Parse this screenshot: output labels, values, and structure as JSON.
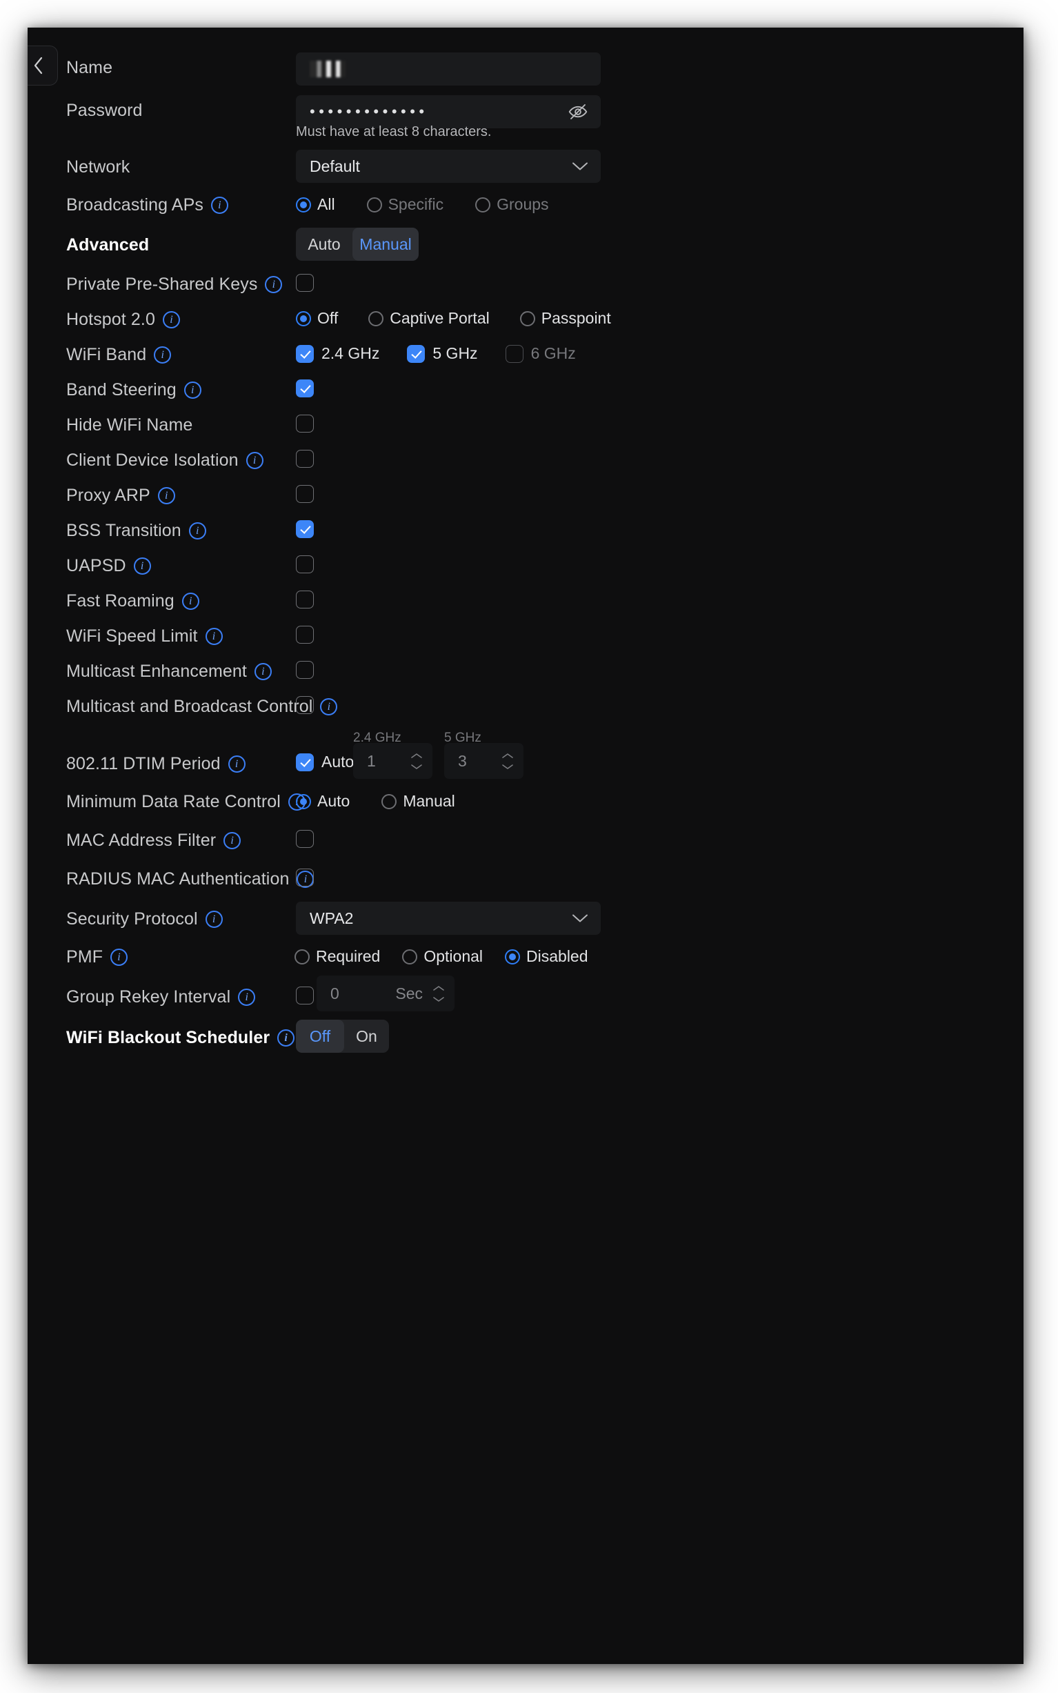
{
  "colors": {
    "panel_bg": "#0e0e0f",
    "accent": "#3d86f8",
    "accent_text": "#5a97fb",
    "field_bg": "#1a1b1d",
    "label": "#c8c9cb",
    "disabled": "#77787c"
  },
  "nav": {
    "back_icon": "chevron-left-icon"
  },
  "fields": {
    "name": {
      "label": "Name",
      "value": "",
      "redacted": true
    },
    "password": {
      "label": "Password",
      "value": "•••••••••••••",
      "helper": "Must have at least 8 characters.",
      "toggle_icon": "eye-off-icon"
    },
    "network": {
      "label": "Network",
      "value": "Default",
      "chevron": "chevron-down-icon"
    },
    "broadcasting_aps": {
      "label": "Broadcasting APs",
      "info": true,
      "options": [
        "All",
        "Specific",
        "Groups"
      ],
      "selected": "All"
    },
    "advanced": {
      "label": "Advanced",
      "bold": true,
      "options": [
        "Auto",
        "Manual"
      ],
      "selected": "Manual"
    },
    "private_psk": {
      "label": "Private Pre-Shared Keys",
      "info": true,
      "checked": false
    },
    "hotspot": {
      "label": "Hotspot 2.0",
      "info": true,
      "options": [
        "Off",
        "Captive Portal",
        "Passpoint"
      ],
      "selected": "Off"
    },
    "wifi_band": {
      "label": "WiFi Band",
      "info": true,
      "options": [
        {
          "label": "2.4 GHz",
          "checked": true,
          "disabled": false
        },
        {
          "label": "5 GHz",
          "checked": true,
          "disabled": false
        },
        {
          "label": "6 GHz",
          "checked": false,
          "disabled": true
        }
      ]
    },
    "band_steering": {
      "label": "Band Steering",
      "info": true,
      "checked": true
    },
    "hide_wifi_name": {
      "label": "Hide WiFi Name",
      "info": false,
      "checked": false
    },
    "client_isolation": {
      "label": "Client Device Isolation",
      "info": true,
      "checked": false
    },
    "proxy_arp": {
      "label": "Proxy ARP",
      "info": true,
      "checked": false
    },
    "bss_transition": {
      "label": "BSS Transition",
      "info": true,
      "checked": true
    },
    "uapsd": {
      "label": "UAPSD",
      "info": true,
      "checked": false
    },
    "fast_roaming": {
      "label": "Fast Roaming",
      "info": true,
      "checked": false
    },
    "wifi_speed_limit": {
      "label": "WiFi Speed Limit",
      "info": true,
      "checked": false
    },
    "multicast_enhancement": {
      "label": "Multicast Enhancement",
      "info": true,
      "checked": false
    },
    "multicast_broadcast_control": {
      "label": "Multicast and Broadcast Control",
      "info": true,
      "checked": false
    },
    "dtim": {
      "label": "802.11 DTIM Period",
      "info": true,
      "auto_label": "Auto",
      "auto_checked": true,
      "band_24_header": "2.4 GHz",
      "band_24_value": "1",
      "band_5_header": "5 GHz",
      "band_5_value": "3"
    },
    "min_data_rate": {
      "label": "Minimum Data Rate Control",
      "info": true,
      "options": [
        "Auto",
        "Manual"
      ],
      "selected": "Auto"
    },
    "mac_filter": {
      "label": "MAC Address Filter",
      "info": true,
      "checked": false
    },
    "radius_mac_auth": {
      "label": "RADIUS MAC Authentication",
      "info": true,
      "checked": false
    },
    "security_protocol": {
      "label": "Security Protocol",
      "info": true,
      "value": "WPA2",
      "chevron": "chevron-down-icon"
    },
    "pmf": {
      "label": "PMF",
      "info": true,
      "options": [
        "Required",
        "Optional",
        "Disabled"
      ],
      "selected": "Disabled"
    },
    "group_rekey": {
      "label": "Group Rekey Interval",
      "info": true,
      "checked": false,
      "value": "0",
      "unit": "Sec"
    },
    "blackout_scheduler": {
      "label": "WiFi Blackout Scheduler",
      "info": true,
      "bold": true,
      "options": [
        "Off",
        "On"
      ],
      "selected": "Off"
    }
  }
}
